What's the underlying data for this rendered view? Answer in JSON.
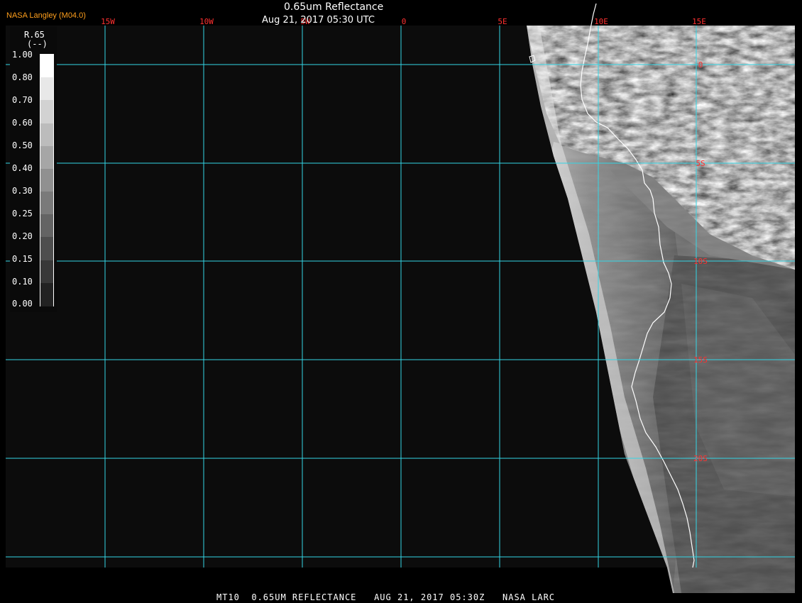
{
  "header": {
    "product_title": "0.65um Reflectance",
    "timestamp": "Aug 21, 2017 05:30 UTC",
    "source_label": "NASA Langley (M04.0)"
  },
  "footer": {
    "caption": "MT10  0.65UM REFLECTANCE   AUG 21, 2017 05:30Z   NASA LARC"
  },
  "colorbar": {
    "variable": "R.65",
    "units": "(--)",
    "tick_labels": [
      "1.00",
      "0.80",
      "0.70",
      "0.60",
      "0.50",
      "0.40",
      "0.30",
      "0.25",
      "0.20",
      "0.15",
      "0.10",
      "0.00"
    ]
  },
  "map": {
    "longitude_labels": [
      "15W",
      "10W",
      "5W",
      "0",
      "5E",
      "10E",
      "15E"
    ],
    "latitude_labels": [
      "0",
      "5S",
      "10S",
      "15S",
      "20S"
    ],
    "colors": {
      "gridline": "#33d6e6",
      "grid_label": "#ff3030",
      "coastline": "#ffffff",
      "background": "#0c0c0c",
      "source_text": "#ff9f1c"
    }
  }
}
